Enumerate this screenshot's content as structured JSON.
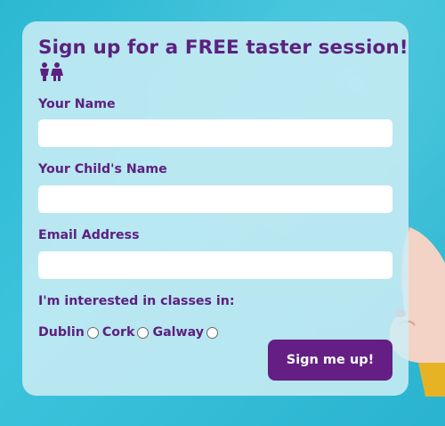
{
  "form": {
    "title": "Sign up for a FREE taster session!",
    "icon": "children-icon",
    "fields": [
      {
        "label": "Your Name",
        "value": ""
      },
      {
        "label": "Your Child's Name",
        "value": ""
      },
      {
        "label": "Email Address",
        "value": ""
      }
    ],
    "interest_label": "I'm interested in classes in:",
    "cities": [
      {
        "label": "Dublin",
        "selected": false
      },
      {
        "label": "Cork",
        "selected": false
      },
      {
        "label": "Galway",
        "selected": false
      }
    ],
    "submit_label": "Sign me up!"
  },
  "colors": {
    "background": "#34bcd6",
    "card": "#cdeef5",
    "text": "#5d2080",
    "button": "#651e84"
  }
}
